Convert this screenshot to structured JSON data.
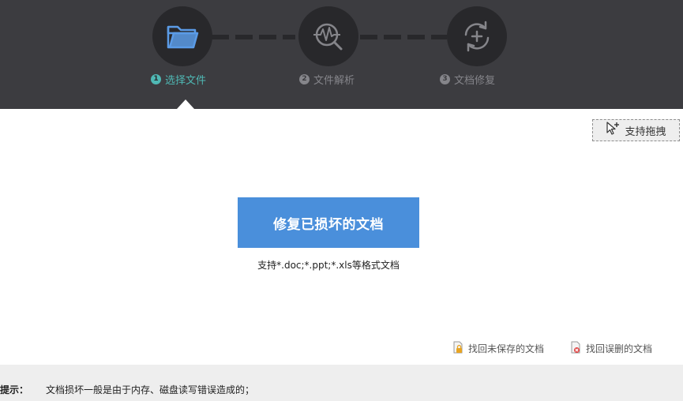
{
  "steps": [
    {
      "num": "1",
      "label": "选择文件",
      "icon": "folder-icon",
      "active": true
    },
    {
      "num": "2",
      "label": "文件解析",
      "icon": "analyze-icon",
      "active": false
    },
    {
      "num": "3",
      "label": "文档修复",
      "icon": "repair-icon",
      "active": false
    }
  ],
  "drag": {
    "label": "支持拖拽",
    "icon": "cursor-plus-icon"
  },
  "main": {
    "repair_button": "修复已损坏的文档",
    "support_formats": "支持*.doc;*.ppt;*.xls等格式文档"
  },
  "links": {
    "recover_unsaved": "找回未保存的文档",
    "recover_deleted": "找回误删的文档"
  },
  "tip": {
    "label": "提示：",
    "text": "文档损坏一般是由于内存、磁盘读写错误造成的；"
  },
  "colors": {
    "header_bg": "#3c3c40",
    "circle_bg": "#28282b",
    "active_step": "#4fb8b4",
    "inactive_step": "#85858a",
    "button_bg": "#4a8fdb",
    "folder_icon": "#5b9be6",
    "tip_bg": "#eeeeee"
  }
}
